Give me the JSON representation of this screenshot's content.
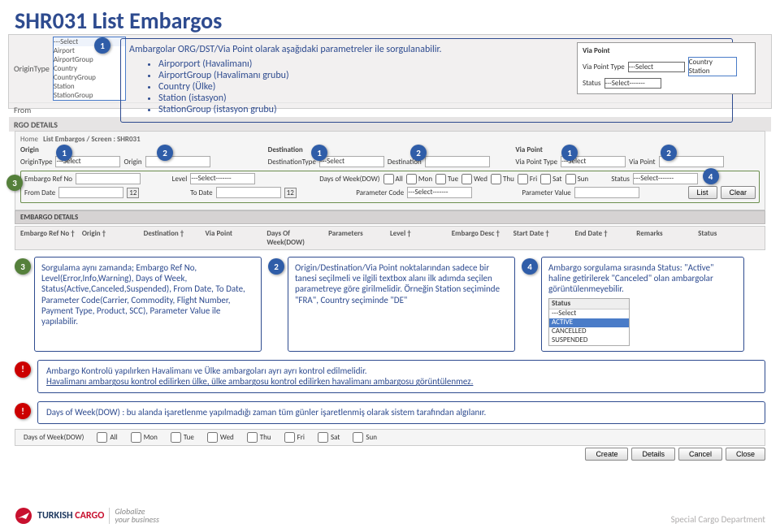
{
  "title": "SHR031 List Embargos",
  "intro": {
    "lead": "Ambargolar ORG/DST/Via Point olarak aşağıdaki parametreler ile sorgulanabilir.",
    "items": [
      "Airporport (Havalimanı)",
      "AirportGroup (Havalimanı grubu)",
      "Country (Ülke)",
      "Station (istasyon)",
      "StationGroup (istasyon grubu)"
    ]
  },
  "originDropdown": {
    "label": "OriginType",
    "placeholder": "---Select",
    "options": [
      "Airport",
      "AirportGroup",
      "Country",
      "CountryGroup",
      "Station",
      "StationGroup"
    ]
  },
  "bgLabels": {
    "from": "From",
    "rgo": "RGO DETAILS"
  },
  "viapoint": {
    "header": "Via Point",
    "typeLabel": "Via Point Type",
    "statusLabel": "Status",
    "typeSel": "---Select",
    "statusSel": "---Select-------",
    "options": [
      "Country",
      "Station"
    ]
  },
  "filter": {
    "home": "Home",
    "screen": "List Embargos / Screen : SHR031",
    "origin": "Origin",
    "originType": "OriginType",
    "originSel": "---Select",
    "destination": "Destination",
    "destType": "DestinationType",
    "destSel": "---Select",
    "dest2": "Destination",
    "viaPoint": "Via Point",
    "viaType": "Via Point Type",
    "viaSel": "---Select",
    "embRef": "Embargo Ref No",
    "level": "Level",
    "levelSel": "---Select-------",
    "dowLabel": "Days of Week(DOW)",
    "dow": [
      "All",
      "Mon",
      "Tue",
      "Wed",
      "Thu",
      "Fri",
      "Sat",
      "Sun"
    ],
    "status": "Status",
    "statusSel": "---Select-------",
    "fromDate": "From Date",
    "toDate": "To Date",
    "paramCode": "Parameter Code",
    "paramCodeSel": "---Select-------",
    "paramVal": "Parameter Value",
    "cal": "12",
    "list": "List",
    "clear": "Clear"
  },
  "embargoDetails": "EMBARGO DETAILS",
  "tableCols": [
    "Embargo Ref No †",
    "Origin †",
    "Destination †",
    "Via Point",
    "Days Of Week(DOW)",
    "Parameters",
    "Level †",
    "Embargo Desc †",
    "Start Date †",
    "End Date †",
    "Remarks",
    "Status"
  ],
  "callout3": "Sorgulama aynı zamanda; Embargo Ref No, Level(Error,Info,Warning), Days of Week, Status(Active,Canceled,Suspended), From Date, To Date, Parameter Code(Carrier, Commodity, Flight Number, Payment Type, Product, SCC), Parameter Value ile yapılabilir.",
  "callout2": "Origin/Destination/Via Point noktalarından sadece bir tanesi seçilmeli ve ilgili textbox alanı ilk adımda seçilen parametreye göre girilmelidir. Örneğin Station seçiminde \"FRA\", Country seçiminde \"DE\"",
  "callout4": "Ambargo sorgulama sırasında Status: \"Active\" haline getirilerek \"Canceled\" olan ambargolar görüntülenmeyebilir.",
  "statusList": {
    "header": "Status",
    "items": [
      "---Select",
      "ACTIVE",
      "CANCELLED",
      "SUSPENDED"
    ],
    "selected": "ACTIVE"
  },
  "alert1a": "Ambargo Kontrolü yapılırken Havalimanı ve Ülke ambargoları ayrı ayrı kontrol edilmelidir.",
  "alert1b": "Havalimanı ambargosu kontrol edilirken ülke, ülke ambargosu kontrol edilirken havalimanı ambargosu görüntülenmez.",
  "alert2": "Days of Week(DOW) : bu alanda işaretlenme yapılmadığı zaman tüm günler işaretlenmiş olarak sistem tarafından algılanır.",
  "dowStrip": {
    "label": "Days of Week(DOW)",
    "days": [
      "All",
      "Mon",
      "Tue",
      "Wed",
      "Thu",
      "Fri",
      "Sat",
      "Sun"
    ]
  },
  "bottomBtns": [
    "Create",
    "Details",
    "Cancel",
    "Close"
  ],
  "footer": {
    "brand1": "TURKISH",
    "brand2": "CARGO",
    "tag1": "Globalize",
    "tag2": "your business",
    "dept": "Special Cargo Department"
  }
}
